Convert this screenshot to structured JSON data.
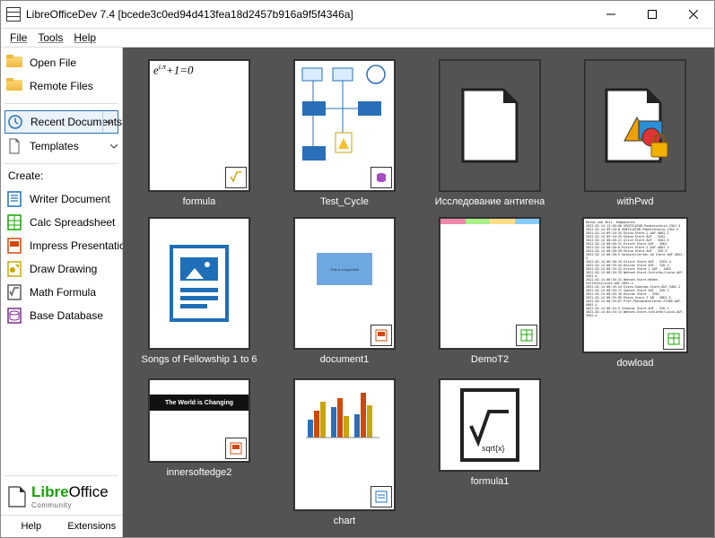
{
  "window": {
    "title": "LibreOfficeDev 7.4 [bcede3c0ed94d413fea18d2457b916a9f5f4346a]"
  },
  "menubar": [
    "File",
    "Tools",
    "Help"
  ],
  "sidebar": {
    "open_file": "Open File",
    "remote_files": "Remote Files",
    "recent_documents": "Recent Documents",
    "templates": "Templates",
    "create_label": "Create:",
    "writer": "Writer Document",
    "calc": "Calc Spreadsheet",
    "impress": "Impress Presentation",
    "draw": "Draw Drawing",
    "math": "Math Formula",
    "base": "Base Database",
    "logo_main": "LibreOffice",
    "logo_sub": "Community",
    "help": "Help",
    "extensions": "Extensions"
  },
  "documents": [
    {
      "name": "formula",
      "type": "math"
    },
    {
      "name": "Test_Cycle",
      "type": "draw"
    },
    {
      "name": "Исследование антигена",
      "type": "generic"
    },
    {
      "name": "withPwd",
      "type": "locked"
    },
    {
      "name": "Songs of Fellowship 1 to 6",
      "type": "writer"
    },
    {
      "name": "document1",
      "type": "impress"
    },
    {
      "name": "DemoT2",
      "type": "calc"
    },
    {
      "name": "dowload",
      "type": "calc-text"
    },
    {
      "name": "innersoftedge2",
      "type": "impress-dark"
    },
    {
      "name": "chart",
      "type": "writer-chart"
    },
    {
      "name": "formula1",
      "type": "math-big"
    }
  ],
  "thumb_text": {
    "formula_expr": "e^{i·π}+1=0",
    "impress_dark": "The World is Changing",
    "math_big": "sqrt{x}"
  },
  "colors": {
    "writer": "#1e6fb8",
    "calc": "#18a303",
    "impress": "#d0480a",
    "draw": "#c9a50a",
    "math": "#5a5a5a",
    "base": "#7b2d8e"
  }
}
